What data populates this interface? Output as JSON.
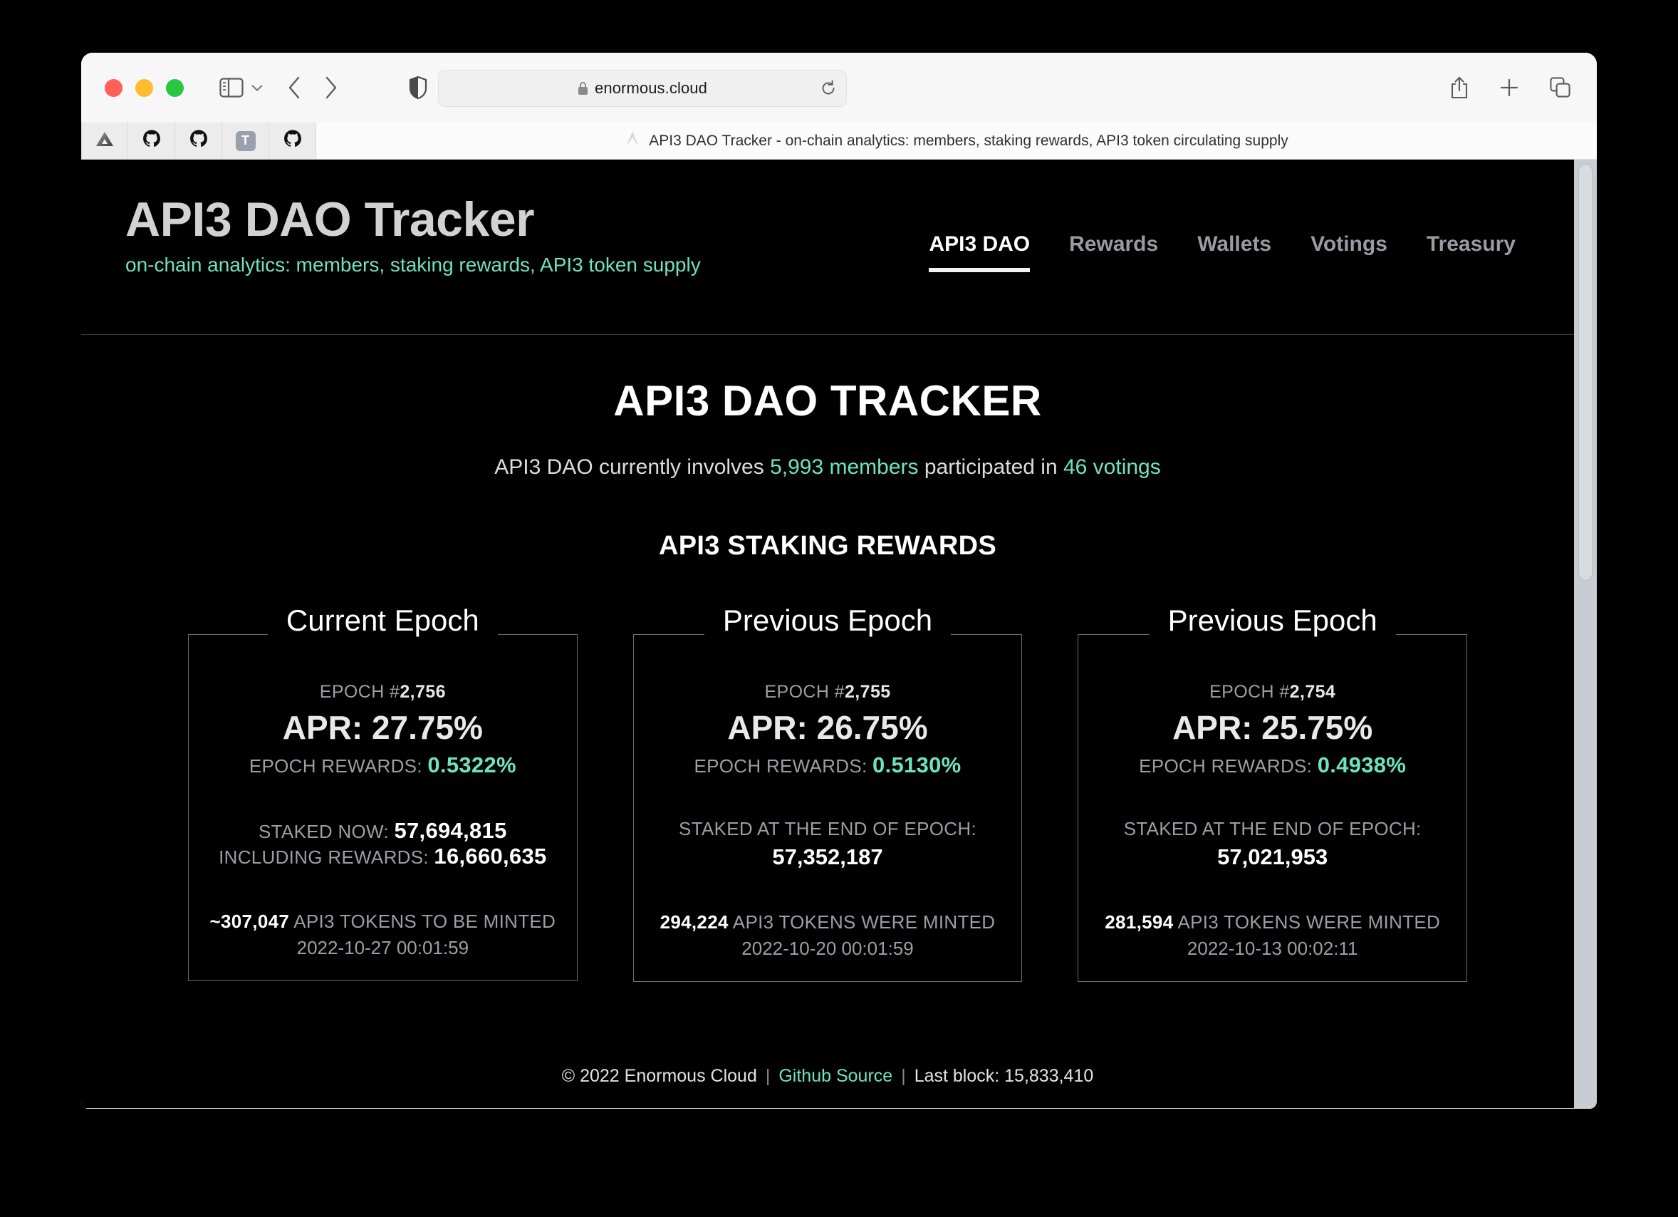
{
  "browser": {
    "url": "enormous.cloud",
    "lock_icon": "lock-icon",
    "reload_icon": "reload-icon",
    "active_tab_title": "API3 DAO Tracker - on-chain analytics: members, staking rewards, API3 token circulating supply",
    "pinned_tabs": [
      {
        "name": "pinned-tab-vercel",
        "icon": "triangle-icon"
      },
      {
        "name": "pinned-tab-github-1",
        "icon": "github-icon"
      },
      {
        "name": "pinned-tab-github-2",
        "icon": "github-icon"
      },
      {
        "name": "pinned-tab-t",
        "icon": "letter-t-icon",
        "label": "T"
      },
      {
        "name": "pinned-tab-github-3",
        "icon": "github-icon"
      }
    ]
  },
  "site": {
    "title": "API3 DAO Tracker",
    "subtitle": "on-chain analytics: members, staking rewards, API3 token supply",
    "nav": [
      {
        "label": "API3 DAO",
        "active": true
      },
      {
        "label": "Rewards",
        "active": false
      },
      {
        "label": "Wallets",
        "active": false
      },
      {
        "label": "Votings",
        "active": false
      },
      {
        "label": "Treasury",
        "active": false
      }
    ]
  },
  "main": {
    "heading": "API3 DAO TRACKER",
    "involvement": {
      "prefix": "API3 DAO currently involves ",
      "members": "5,993 members",
      "middle": " participated in ",
      "votings": "46 votings"
    },
    "rewards_heading": "API3 STAKING REWARDS"
  },
  "epochs": [
    {
      "title": "Current Epoch",
      "epoch_label": "EPOCH #",
      "epoch_number": "2,756",
      "apr": "APR: 27.75%",
      "rewards_label": "EPOCH REWARDS: ",
      "rewards_value": "0.5322%",
      "staked_label": "STAKED NOW: ",
      "staked_value": "57,694,815",
      "including_label": "INCLUDING REWARDS: ",
      "including_value": "16,660,635",
      "minted_value": "~307,047",
      "minted_label": " API3 TOKENS TO BE MINTED",
      "minted_date": "2022-10-27 00:01:59"
    },
    {
      "title": "Previous Epoch",
      "epoch_label": "EPOCH #",
      "epoch_number": "2,755",
      "apr": "APR: 26.75%",
      "rewards_label": "EPOCH REWARDS: ",
      "rewards_value": "0.5130%",
      "staked_end_label": "STAKED AT THE END OF EPOCH:",
      "staked_end_value": "57,352,187",
      "minted_value": "294,224",
      "minted_label": " API3 TOKENS WERE MINTED",
      "minted_date": "2022-10-20 00:01:59"
    },
    {
      "title": "Previous Epoch",
      "epoch_label": "EPOCH #",
      "epoch_number": "2,754",
      "apr": "APR: 25.75%",
      "rewards_label": "EPOCH REWARDS: ",
      "rewards_value": "0.4938%",
      "staked_end_label": "STAKED AT THE END OF EPOCH:",
      "staked_end_value": "57,021,953",
      "minted_value": "281,594",
      "minted_label": " API3 TOKENS WERE MINTED",
      "minted_date": "2022-10-13 00:02:11"
    }
  ],
  "footer": {
    "copyright": "© 2022 Enormous Cloud",
    "github_link": "Github Source",
    "last_block": "Last block: 15,833,410"
  },
  "colors": {
    "accent": "#6fe3bf",
    "background": "#000000",
    "title": "#d2d2d2"
  }
}
